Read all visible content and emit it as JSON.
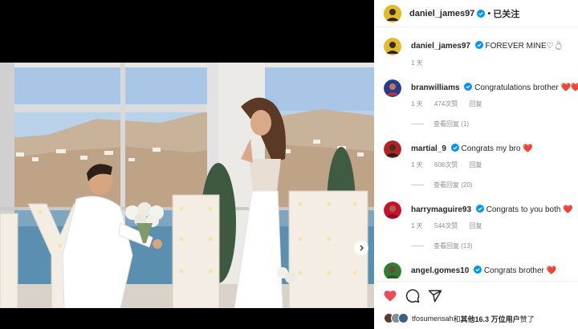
{
  "post": {
    "author": "daniel_james97",
    "follow_status": "已关注",
    "caption": "FOREVER MINE",
    "caption_emoji": "♡💍",
    "time": "1 天"
  },
  "comments": [
    {
      "user": "branwilliams",
      "text": "Congratulations brother",
      "emoji": "❤️❤️",
      "time": "1 天",
      "likes": "474次赞",
      "reply": "回复",
      "view_replies": "查看回复 (1)",
      "liked": true
    },
    {
      "user": "martial_9",
      "text": "Congrats my bro",
      "emoji": "❤️",
      "time": "1 天",
      "likes": "608次赞",
      "reply": "回复",
      "view_replies": "查看回复 (20)",
      "liked": false
    },
    {
      "user": "harrymaguire93",
      "text": "Congrats to you both",
      "emoji": "❤️",
      "time": "1 天",
      "likes": "544次赞",
      "reply": "回复",
      "view_replies": "查看回复 (13)",
      "liked": false
    },
    {
      "user": "angel.gomes10",
      "text": "Congrats brother",
      "emoji": "❤️",
      "liked": false
    }
  ],
  "likes_line": {
    "user": "tfosumensah",
    "and": "和",
    "others": "其他16.3 万位用户",
    "suffix": "赞了"
  },
  "colors": {
    "like_red": "#ed4956",
    "verified_blue": "#0095f6"
  },
  "icons": [
    "heart-icon",
    "comment-icon",
    "share-icon",
    "verified-badge-icon",
    "chevron-right-icon"
  ]
}
